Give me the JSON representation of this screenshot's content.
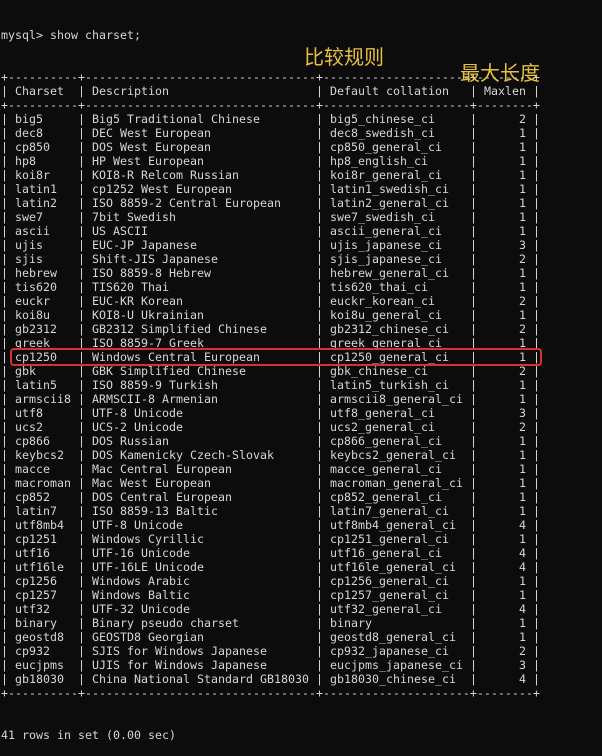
{
  "prompt": "mysql> show charset;",
  "columns": [
    "Charset",
    "Description",
    "Default collation",
    "Maxlen"
  ],
  "rows": [
    [
      "big5",
      "Big5 Traditional Chinese",
      "big5_chinese_ci",
      "2"
    ],
    [
      "dec8",
      "DEC West European",
      "dec8_swedish_ci",
      "1"
    ],
    [
      "cp850",
      "DOS West European",
      "cp850_general_ci",
      "1"
    ],
    [
      "hp8",
      "HP West European",
      "hp8_english_ci",
      "1"
    ],
    [
      "koi8r",
      "KOI8-R Relcom Russian",
      "koi8r_general_ci",
      "1"
    ],
    [
      "latin1",
      "cp1252 West European",
      "latin1_swedish_ci",
      "1"
    ],
    [
      "latin2",
      "ISO 8859-2 Central European",
      "latin2_general_ci",
      "1"
    ],
    [
      "swe7",
      "7bit Swedish",
      "swe7_swedish_ci",
      "1"
    ],
    [
      "ascii",
      "US ASCII",
      "ascii_general_ci",
      "1"
    ],
    [
      "ujis",
      "EUC-JP Japanese",
      "ujis_japanese_ci",
      "3"
    ],
    [
      "sjis",
      "Shift-JIS Japanese",
      "sjis_japanese_ci",
      "2"
    ],
    [
      "hebrew",
      "ISO 8859-8 Hebrew",
      "hebrew_general_ci",
      "1"
    ],
    [
      "tis620",
      "TIS620 Thai",
      "tis620_thai_ci",
      "1"
    ],
    [
      "euckr",
      "EUC-KR Korean",
      "euckr_korean_ci",
      "2"
    ],
    [
      "koi8u",
      "KOI8-U Ukrainian",
      "koi8u_general_ci",
      "1"
    ],
    [
      "gb2312",
      "GB2312 Simplified Chinese",
      "gb2312_chinese_ci",
      "2"
    ],
    [
      "greek",
      "ISO 8859-7 Greek",
      "greek_general_ci",
      "1"
    ],
    [
      "cp1250",
      "Windows Central European",
      "cp1250_general_ci",
      "1"
    ],
    [
      "gbk",
      "GBK Simplified Chinese",
      "gbk_chinese_ci",
      "2"
    ],
    [
      "latin5",
      "ISO 8859-9 Turkish",
      "latin5_turkish_ci",
      "1"
    ],
    [
      "armscii8",
      "ARMSCII-8 Armenian",
      "armscii8_general_ci",
      "1"
    ],
    [
      "utf8",
      "UTF-8 Unicode",
      "utf8_general_ci",
      "3"
    ],
    [
      "ucs2",
      "UCS-2 Unicode",
      "ucs2_general_ci",
      "2"
    ],
    [
      "cp866",
      "DOS Russian",
      "cp866_general_ci",
      "1"
    ],
    [
      "keybcs2",
      "DOS Kamenicky Czech-Slovak",
      "keybcs2_general_ci",
      "1"
    ],
    [
      "macce",
      "Mac Central European",
      "macce_general_ci",
      "1"
    ],
    [
      "macroman",
      "Mac West European",
      "macroman_general_ci",
      "1"
    ],
    [
      "cp852",
      "DOS Central European",
      "cp852_general_ci",
      "1"
    ],
    [
      "latin7",
      "ISO 8859-13 Baltic",
      "latin7_general_ci",
      "1"
    ],
    [
      "utf8mb4",
      "UTF-8 Unicode",
      "utf8mb4_general_ci",
      "4"
    ],
    [
      "cp1251",
      "Windows Cyrillic",
      "cp1251_general_ci",
      "1"
    ],
    [
      "utf16",
      "UTF-16 Unicode",
      "utf16_general_ci",
      "4"
    ],
    [
      "utf16le",
      "UTF-16LE Unicode",
      "utf16le_general_ci",
      "4"
    ],
    [
      "cp1256",
      "Windows Arabic",
      "cp1256_general_ci",
      "1"
    ],
    [
      "cp1257",
      "Windows Baltic",
      "cp1257_general_ci",
      "1"
    ],
    [
      "utf32",
      "UTF-32 Unicode",
      "utf32_general_ci",
      "4"
    ],
    [
      "binary",
      "Binary pseudo charset",
      "binary",
      "1"
    ],
    [
      "geostd8",
      "GEOSTD8 Georgian",
      "geostd8_general_ci",
      "1"
    ],
    [
      "cp932",
      "SJIS for Windows Japanese",
      "cp932_japanese_ci",
      "2"
    ],
    [
      "eucjpms",
      "UJIS for Windows Japanese",
      "eucjpms_japanese_ci",
      "3"
    ],
    [
      "gb18030",
      "China National Standard GB18030",
      "gb18030_chinese_ci",
      "4"
    ]
  ],
  "footer": "41 rows in set (0.00 sec)",
  "annotations": {
    "collation": "比较规则",
    "maxlen": "最大长度"
  },
  "colors": {
    "background": "#0c0c0c",
    "text": "#d6d6d6",
    "highlight": "#d8322f",
    "annotation": "#e8c040"
  }
}
